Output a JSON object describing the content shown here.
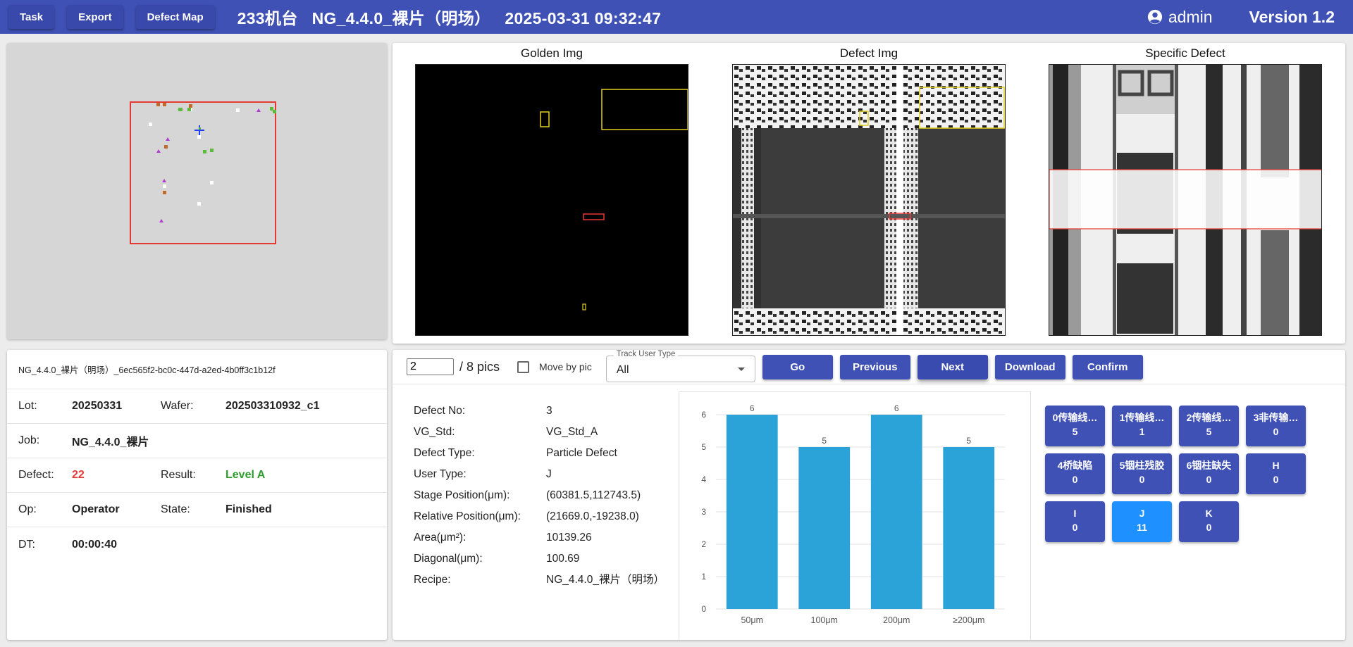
{
  "topbar": {
    "buttons": [
      "Task",
      "Export",
      "Defect Map"
    ],
    "title": "233机台   NG_4.4.0_裸片（明场）   2025-03-31 09:32:47",
    "user": "admin",
    "version": "Version 1.2"
  },
  "images": {
    "golden_caption": "Golden Img",
    "defect_caption": "Defect Img",
    "specific_caption": "Specific Defect"
  },
  "info": {
    "lot_id": "NG_4.4.0_裸片（明场）_6ec565f2-bc0c-447d-a2ed-4b0ff3c1b12f",
    "lot_label": "Lot:",
    "lot_value": "20250331",
    "wafer_label": "Wafer:",
    "wafer_value": "202503310932_c1",
    "job_label": "Job:",
    "job_value": "NG_4.4.0_裸片",
    "defect_label": "Defect:",
    "defect_value": "22",
    "result_label": "Result:",
    "result_value": "Level A",
    "op_label": "Op:",
    "op_value": "Operator",
    "state_label": "State:",
    "state_value": "Finished",
    "dt_label": "DT:",
    "dt_value": "00:00:40"
  },
  "controls": {
    "pic_value": "2",
    "pic_total": "/ 8 pics",
    "move_by_pic": "Move by pic",
    "track_label": "Track User Type",
    "track_value": "All",
    "go": "Go",
    "previous": "Previous",
    "next": "Next",
    "download": "Download",
    "confirm": "Confirm"
  },
  "details": [
    {
      "label": "Defect No:",
      "value": "3"
    },
    {
      "label": "VG_Std:",
      "value": "VG_Std_A"
    },
    {
      "label": "Defect Type:",
      "value": "Particle Defect"
    },
    {
      "label": "User Type:",
      "value": "J"
    },
    {
      "label": "Stage Position(μm):",
      "value": "(60381.5,112743.5)"
    },
    {
      "label": "Relative Position(μm):",
      "value": "(21669.0,-19238.0)"
    },
    {
      "label": "Area(μm²):",
      "value": "10139.26"
    },
    {
      "label": "Diagonal(μm):",
      "value": "100.69"
    },
    {
      "label": "Recipe:",
      "value": "NG_4.4.0_裸片（明场）"
    }
  ],
  "chart_data": {
    "type": "bar",
    "categories": [
      "50μm",
      "100μm",
      "200μm",
      "≥200μm"
    ],
    "values": [
      6,
      5,
      6,
      5
    ],
    "ylim": [
      0,
      6
    ],
    "yticks": [
      0,
      1,
      2,
      3,
      4,
      5,
      6
    ],
    "grid": true,
    "color": "#2ba3d8"
  },
  "defect_types": [
    {
      "name": "0传输线…",
      "count": "5"
    },
    {
      "name": "1传输线…",
      "count": "1"
    },
    {
      "name": "2传输线…",
      "count": "5"
    },
    {
      "name": "3非传输…",
      "count": "0"
    },
    {
      "name": "4桥缺陷",
      "count": "0"
    },
    {
      "name": "5铟柱残胶",
      "count": "0"
    },
    {
      "name": "6铟柱缺失",
      "count": "0"
    },
    {
      "name": "H",
      "count": "0"
    },
    {
      "name": "I",
      "count": "0"
    },
    {
      "name": "J",
      "count": "11",
      "active": true
    },
    {
      "name": "K",
      "count": "0"
    }
  ],
  "colors": {
    "primary": "#3f51b5",
    "active": "#1e90ff",
    "bar": "#2ba3d8",
    "defect_red": "#e53935",
    "result_green": "#2e9d2e"
  }
}
